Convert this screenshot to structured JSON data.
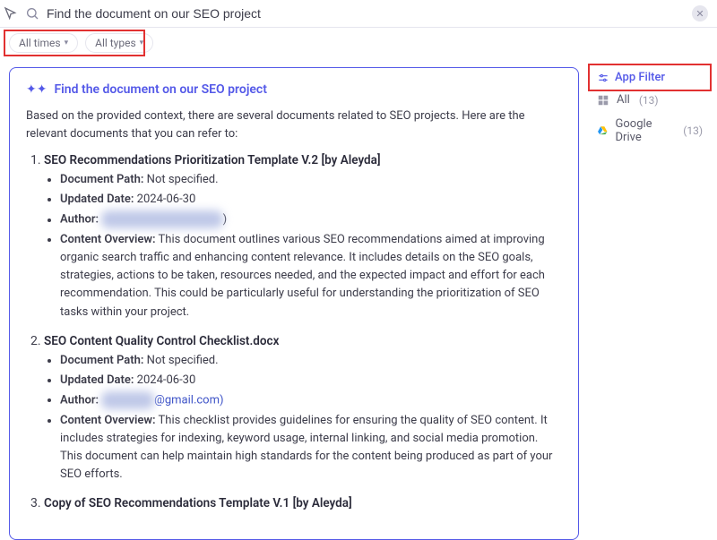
{
  "search": {
    "value": "Find the document on our SEO project"
  },
  "filters": {
    "time_label": "All times",
    "type_label": "All types"
  },
  "card": {
    "title": "Find the document on our SEO project",
    "intro": "Based on the provided context, there are several documents related to SEO projects. Here are the relevant documents that you can refer to:",
    "items": [
      {
        "title": "SEO Recommendations Prioritization Template V.2 [by Aleyda]",
        "path_label": "Document Path:",
        "path_value": "Not specified.",
        "date_label": "Updated Date:",
        "date_value": "2024-06-30",
        "author_label": "Author:",
        "author_masked": "redacted author name",
        "author_suffix": ")",
        "overview_label": "Content Overview:",
        "overview_value": "This document outlines various SEO recommendations aimed at improving organic search traffic and enhancing content relevance. It includes details on the SEO goals, strategies, actions to be taken, resources needed, and the expected impact and effort for each recommendation. This could be particularly useful for understanding the prioritization of SEO tasks within your project."
      },
      {
        "title": "SEO Content Quality Control Checklist.docx",
        "path_label": "Document Path:",
        "path_value": "Not specified.",
        "date_label": "Updated Date:",
        "date_value": "2024-06-30",
        "author_label": "Author:",
        "author_masked": "redacted",
        "author_suffix": "@gmail.com)",
        "overview_label": "Content Overview:",
        "overview_value": "This checklist provides guidelines for ensuring the quality of SEO content. It includes strategies for indexing, keyword usage, internal linking, and social media promotion. This document can help maintain high standards for the content being produced as part of your SEO efforts."
      },
      {
        "title": "Copy of SEO Recommendations Template V.1 [by Aleyda]"
      }
    ]
  },
  "sidebar": {
    "app_filter_label": "App Filter",
    "all_label": "All",
    "all_count": "(13)",
    "drive_label": "Google Drive",
    "drive_count": "(13)"
  }
}
